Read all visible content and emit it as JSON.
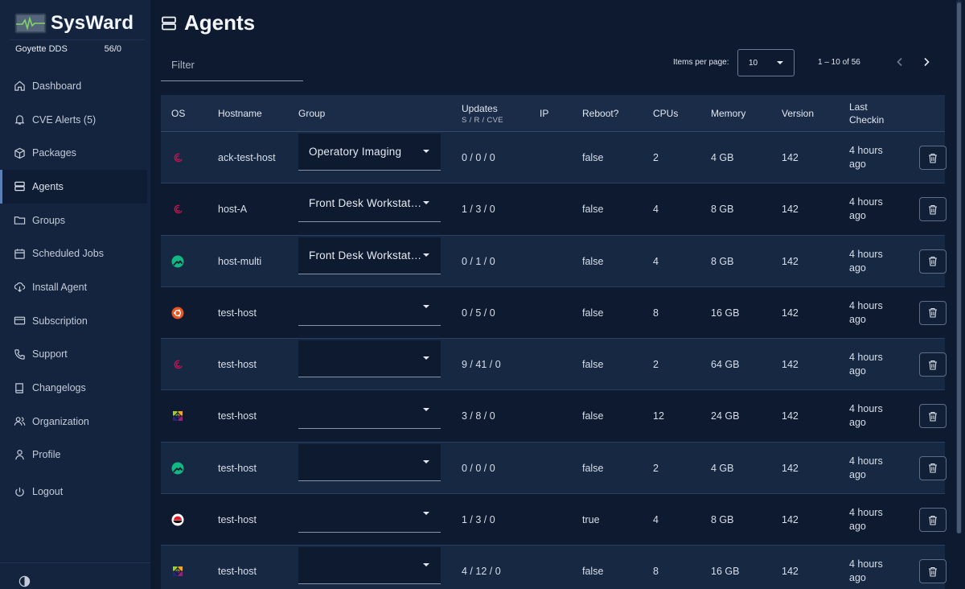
{
  "brand": {
    "name": "SysWard"
  },
  "org": {
    "name": "Goyette DDS",
    "count": "56/0"
  },
  "nav": {
    "items": [
      {
        "label": "Dashboard"
      },
      {
        "label": "CVE Alerts (5)"
      },
      {
        "label": "Packages"
      },
      {
        "label": "Agents"
      },
      {
        "label": "Groups"
      },
      {
        "label": "Scheduled Jobs"
      },
      {
        "label": "Install Agent"
      },
      {
        "label": "Subscription"
      },
      {
        "label": "Support"
      },
      {
        "label": "Changelogs"
      },
      {
        "label": "Organization"
      },
      {
        "label": "Profile"
      },
      {
        "label": "Logout"
      }
    ]
  },
  "page": {
    "title": "Agents"
  },
  "filter": {
    "placeholder": "Filter",
    "value": ""
  },
  "pagination": {
    "items_per_page_label": "Items per page:",
    "items_per_page": "10",
    "range": "1 – 10 of 56"
  },
  "table": {
    "headers": {
      "os": "OS",
      "hostname": "Hostname",
      "group": "Group",
      "updates": "Updates",
      "updates_sub": "S / R / CVE",
      "ip": "IP",
      "reboot": "Reboot?",
      "cpus": "CPUs",
      "memory": "Memory",
      "version": "Version",
      "checkin_line1": "Last",
      "checkin_line2": "Checkin"
    },
    "rows": [
      {
        "os": "debian",
        "hostname": "ack-test-host",
        "group": "Operatory Imaging",
        "updates": "0 / 0 / 0",
        "ip": "",
        "reboot": "false",
        "cpus": "2",
        "memory": "4 GB",
        "version": "142",
        "checkin": "4 hours ago"
      },
      {
        "os": "debian",
        "hostname": "host-A",
        "group": "Front Desk Workstations",
        "updates": "1 / 3 / 0",
        "ip": "",
        "reboot": "false",
        "cpus": "4",
        "memory": "8 GB",
        "version": "142",
        "checkin": "4 hours ago"
      },
      {
        "os": "rocky",
        "hostname": "host-multi",
        "group": "Front Desk Workstations",
        "updates": "0 / 1 / 0",
        "ip": "",
        "reboot": "false",
        "cpus": "4",
        "memory": "8 GB",
        "version": "142",
        "checkin": "4 hours ago"
      },
      {
        "os": "ubuntu",
        "hostname": "test-host",
        "group": "",
        "updates": "0 / 5 / 0",
        "ip": "",
        "reboot": "false",
        "cpus": "8",
        "memory": "16 GB",
        "version": "142",
        "checkin": "4 hours ago"
      },
      {
        "os": "debian",
        "hostname": "test-host",
        "group": "",
        "updates": "9 / 41 / 0",
        "ip": "",
        "reboot": "false",
        "cpus": "2",
        "memory": "64 GB",
        "version": "142",
        "checkin": "4 hours ago"
      },
      {
        "os": "centos",
        "hostname": "test-host",
        "group": "",
        "updates": "3 / 8 / 0",
        "ip": "",
        "reboot": "false",
        "cpus": "12",
        "memory": "24 GB",
        "version": "142",
        "checkin": "4 hours ago"
      },
      {
        "os": "rocky",
        "hostname": "test-host",
        "group": "",
        "updates": "0 / 0 / 0",
        "ip": "",
        "reboot": "false",
        "cpus": "2",
        "memory": "4 GB",
        "version": "142",
        "checkin": "4 hours ago"
      },
      {
        "os": "redhat",
        "hostname": "test-host",
        "group": "",
        "updates": "1 / 3 / 0",
        "ip": "",
        "reboot": "true",
        "cpus": "4",
        "memory": "8 GB",
        "version": "142",
        "checkin": "4 hours ago"
      },
      {
        "os": "centos",
        "hostname": "test-host",
        "group": "",
        "updates": "4 / 12 / 0",
        "ip": "",
        "reboot": "false",
        "cpus": "8",
        "memory": "16 GB",
        "version": "142",
        "checkin": "4 hours ago"
      }
    ]
  },
  "colors": {
    "background": "#0d1a30",
    "sidebar": "#14243e",
    "table_header": "#1a2c48",
    "accent": "#5b7eb5",
    "debian": "#c7124f",
    "rocky": "#10b981",
    "ubuntu": "#e95420",
    "redhat": "#e11d2a"
  },
  "icons": {
    "dashboard": "home-icon",
    "cve": "bell-icon",
    "packages": "box-icon",
    "agents": "server-icon",
    "groups": "folder-icon",
    "scheduled": "calendar-icon",
    "install": "cloud-download-icon",
    "subscription": "credit-card-icon",
    "support": "phone-icon",
    "changelogs": "book-icon",
    "organization": "users-icon",
    "profile": "user-icon",
    "logout": "power-icon",
    "theme": "contrast-icon",
    "delete": "trash-icon"
  }
}
